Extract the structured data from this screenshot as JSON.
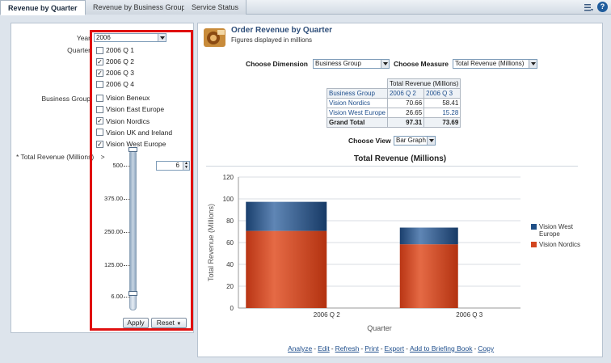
{
  "tabs": [
    {
      "label": "Revenue by Quarter"
    },
    {
      "label": "Revenue by Business Group"
    },
    {
      "label": "Service Status"
    }
  ],
  "prompts": {
    "year_label": "Year",
    "year_value": "2006",
    "quarter_label": "Quarter",
    "quarters": [
      {
        "label": "2006 Q 1",
        "checked": false
      },
      {
        "label": "2006 Q 2",
        "checked": true
      },
      {
        "label": "2006 Q 3",
        "checked": true
      },
      {
        "label": "2006 Q 4",
        "checked": false
      }
    ],
    "business_group_label": "Business Group",
    "business_groups": [
      {
        "label": "Vision Beneux",
        "checked": false
      },
      {
        "label": "Vision East Europe",
        "checked": false
      },
      {
        "label": "Vision Nordics",
        "checked": true
      },
      {
        "label": "Vision UK and Ireland",
        "checked": false
      },
      {
        "label": "Vision West Europe",
        "checked": true
      }
    ],
    "total_revenue_label": "* Total Revenue (Millions)",
    "operator": ">",
    "slider_ticks": [
      "500",
      "375.00",
      "250.00",
      "125.00",
      "6.00"
    ],
    "slider_value": "6",
    "apply_label": "Apply",
    "reset_label": "Reset"
  },
  "report": {
    "title": "Order Revenue by Quarter",
    "subtitle": "Figures displayed in millions",
    "choose_dimension_label": "Choose Dimension",
    "dimension_value": "Business Group",
    "choose_measure_label": "Choose Measure",
    "measure_value": "Total Revenue (Millions)",
    "pivot": {
      "measure_header": "Total Revenue (Millions)",
      "row_header": "Business Group",
      "columns": [
        "2006 Q 2",
        "2006 Q 3"
      ],
      "rows": [
        {
          "label": "Vision Nordics",
          "values": [
            "70.66",
            "58.41"
          ]
        },
        {
          "label": "Vision West Europe",
          "values": [
            "26.65",
            "15.28"
          ]
        }
      ],
      "total": {
        "label": "Grand Total",
        "values": [
          "97.31",
          "73.69"
        ]
      }
    },
    "choose_view_label": "Choose View",
    "view_value": "Bar Graph"
  },
  "chart_data": {
    "type": "bar",
    "stacked": true,
    "title": "Total Revenue (Millions)",
    "xlabel": "Quarter",
    "ylabel": "Total Revenue (Millions)",
    "categories": [
      "2006 Q 2",
      "2006 Q 3"
    ],
    "ylim": [
      0,
      120
    ],
    "yticks": [
      0,
      20,
      40,
      60,
      80,
      100,
      120
    ],
    "series": [
      {
        "name": "Vision Nordics",
        "values": [
          70.66,
          58.41
        ],
        "color": "#d2461f"
      },
      {
        "name": "Vision West Europe",
        "values": [
          26.65,
          15.28
        ],
        "color": "#1f4f86"
      }
    ],
    "legend_position": "right"
  },
  "footer_links": [
    "Analyze",
    "Edit",
    "Refresh",
    "Print",
    "Export",
    "Add to Briefing Book",
    "Copy"
  ],
  "colors": {
    "accent": "#2f4f7a",
    "highlight_box": "#e01010",
    "arrow": "#e01010"
  }
}
